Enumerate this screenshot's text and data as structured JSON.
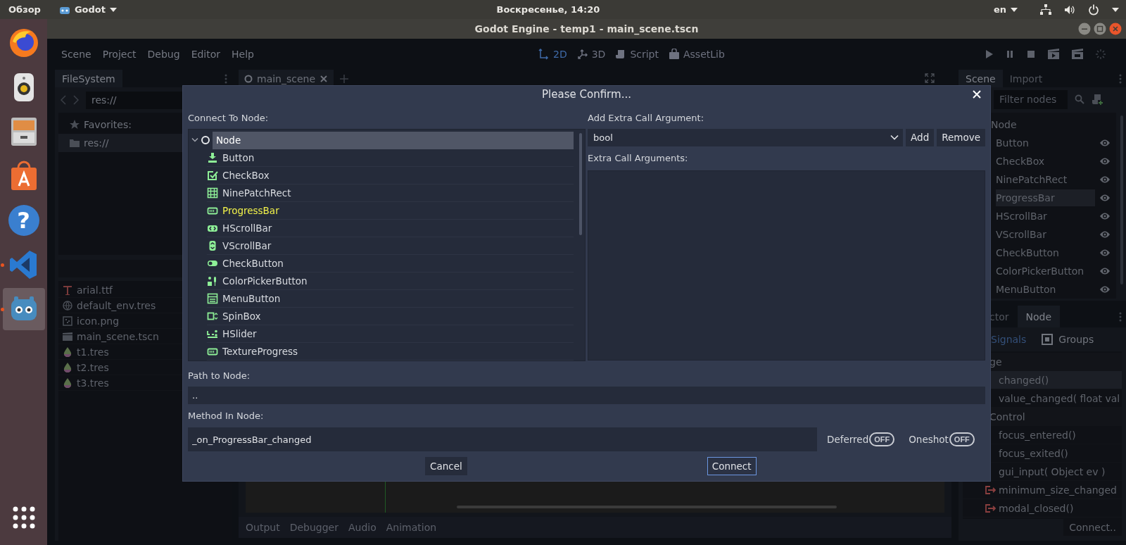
{
  "top_bar": {
    "activities": "Обзор",
    "app": "Godot",
    "clock": "Воскресенье, 14:20",
    "language": "en"
  },
  "launcher": [
    {
      "kind": "firefox",
      "running": false,
      "selected": false
    },
    {
      "kind": "speaker",
      "running": false,
      "selected": false
    },
    {
      "kind": "files",
      "running": false,
      "selected": false
    },
    {
      "kind": "store",
      "running": false,
      "selected": false
    },
    {
      "kind": "help",
      "glyph": "?",
      "running": false,
      "selected": false
    },
    {
      "kind": "vscode",
      "running": true,
      "selected": false
    },
    {
      "kind": "godot",
      "running": true,
      "selected": true
    }
  ],
  "window": {
    "title": "Godot Engine - temp1 - main_scene.tscn"
  },
  "menu": [
    "Scene",
    "Project",
    "Debug",
    "Editor",
    "Help"
  ],
  "workspaces": [
    {
      "kind": "twod",
      "label": "2D",
      "selected": true
    },
    {
      "kind": "threed",
      "label": "3D",
      "selected": false
    },
    {
      "kind": "script",
      "label": "Script",
      "selected": false
    },
    {
      "kind": "assetlib",
      "label": "AssetLib",
      "selected": false
    }
  ],
  "filesystem": {
    "tab": "FileSystem",
    "path": "res://",
    "favorites": "Favorites:",
    "tree": [
      {
        "label": "res://",
        "selected": true
      }
    ],
    "files": [
      {
        "kind": "font",
        "name": "arial.ttf"
      },
      {
        "kind": "environment",
        "name": "default_env.tres"
      },
      {
        "kind": "image",
        "name": "icon.png"
      },
      {
        "kind": "scene",
        "name": "main_scene.tscn"
      },
      {
        "kind": "theme",
        "name": "t1.tres"
      },
      {
        "kind": "theme",
        "name": "t2.tres"
      },
      {
        "kind": "theme",
        "name": "t3.tres"
      }
    ]
  },
  "scene_tabs": [
    {
      "label": "main_scene",
      "selected": true
    }
  ],
  "bottom_tabs": [
    "Output",
    "Debugger",
    "Audio",
    "Animation"
  ],
  "scene_dock": {
    "tabs": [
      {
        "label": "Scene",
        "selected": true
      },
      {
        "label": "Import",
        "selected": false
      }
    ],
    "filter": {
      "placeholder": "Filter nodes"
    },
    "tree": {
      "label": "Node",
      "children": [
        {
          "label": "Button",
          "selected": false,
          "visible": true
        },
        {
          "label": "CheckBox",
          "selected": false,
          "visible": true
        },
        {
          "label": "NinePatchRect",
          "selected": false,
          "visible": true
        },
        {
          "label": "ProgressBar",
          "selected": true,
          "visible": true
        },
        {
          "label": "HScrollBar",
          "selected": false,
          "visible": true
        },
        {
          "label": "VScrollBar",
          "selected": false,
          "visible": true
        },
        {
          "label": "CheckButton",
          "selected": false,
          "visible": true
        },
        {
          "label": "ColorPickerButton",
          "selected": false,
          "visible": true
        },
        {
          "label": "MenuButton",
          "selected": false,
          "visible": true
        }
      ]
    }
  },
  "node_dock": {
    "tabs": [
      {
        "label": "ctor",
        "selected": false
      },
      {
        "label": "Node",
        "selected": true
      }
    ],
    "modes": [
      {
        "kind": "signals",
        "label": "Signals",
        "selected": true
      },
      {
        "kind": "groups",
        "label": "Groups",
        "selected": false
      }
    ],
    "signals": [
      {
        "label": "ge",
        "children": [
          {
            "label": "changed()",
            "selected": true,
            "icon": false
          },
          {
            "label": "value_changed( float val",
            "selected": false,
            "icon": false
          }
        ]
      },
      {
        "label": "Control",
        "children": [
          {
            "label": "focus_entered()",
            "selected": false,
            "icon": false
          },
          {
            "label": "focus_exited()",
            "selected": false,
            "icon": false
          },
          {
            "label": "gui_input( Object ev )",
            "selected": false,
            "icon": false
          },
          {
            "label": "minimum_size_changed",
            "selected": false,
            "icon": true
          },
          {
            "label": "modal_closed()",
            "selected": false,
            "icon": true
          }
        ]
      }
    ],
    "connect_button": "Connect.."
  },
  "dialog": {
    "title": "Please Confirm...",
    "connect_label": "Connect To Node:",
    "tree": {
      "label": "Node",
      "expanded": true,
      "selected": true,
      "children": [
        {
          "kind": "button",
          "label": "Button",
          "selected": false,
          "highlighted": false
        },
        {
          "kind": "checkbox",
          "label": "CheckBox",
          "selected": false,
          "highlighted": false
        },
        {
          "kind": "ninepatch",
          "label": "NinePatchRect",
          "selected": false,
          "highlighted": false
        },
        {
          "kind": "progressbar",
          "label": "ProgressBar",
          "selected": false,
          "highlighted": true
        },
        {
          "kind": "hscrollbar",
          "label": "HScrollBar",
          "selected": false,
          "highlighted": false
        },
        {
          "kind": "vscrollbar",
          "label": "VScrollBar",
          "selected": false,
          "highlighted": false
        },
        {
          "kind": "checkbutton",
          "label": "CheckButton",
          "selected": false,
          "highlighted": false
        },
        {
          "kind": "colorpicker",
          "label": "ColorPickerButton",
          "selected": false,
          "highlighted": false
        },
        {
          "kind": "menubutton",
          "label": "MenuButton",
          "selected": false,
          "highlighted": false
        },
        {
          "kind": "spinbox",
          "label": "SpinBox",
          "selected": false,
          "highlighted": false
        },
        {
          "kind": "hslider",
          "label": "HSlider",
          "selected": false,
          "highlighted": false
        },
        {
          "kind": "progressbar",
          "label": "TextureProgress",
          "selected": false,
          "highlighted": false
        }
      ]
    },
    "extra_label": "Add Extra Call Argument:",
    "arg_type": "bool",
    "add": "Add",
    "remove": "Remove",
    "args_label": "Extra Call Arguments:",
    "path_label": "Path to Node:",
    "path": "..",
    "method_label": "Method In Node:",
    "method": "_on_ProgressBar_changed",
    "toggles": [
      {
        "label": "Deferred",
        "on": false,
        "state": "OFF"
      },
      {
        "label": "Oneshot",
        "on": false,
        "state": "OFF"
      }
    ],
    "buttons": [
      {
        "label": "Cancel",
        "focused": false
      },
      {
        "label": "Connect",
        "focused": true
      }
    ]
  }
}
